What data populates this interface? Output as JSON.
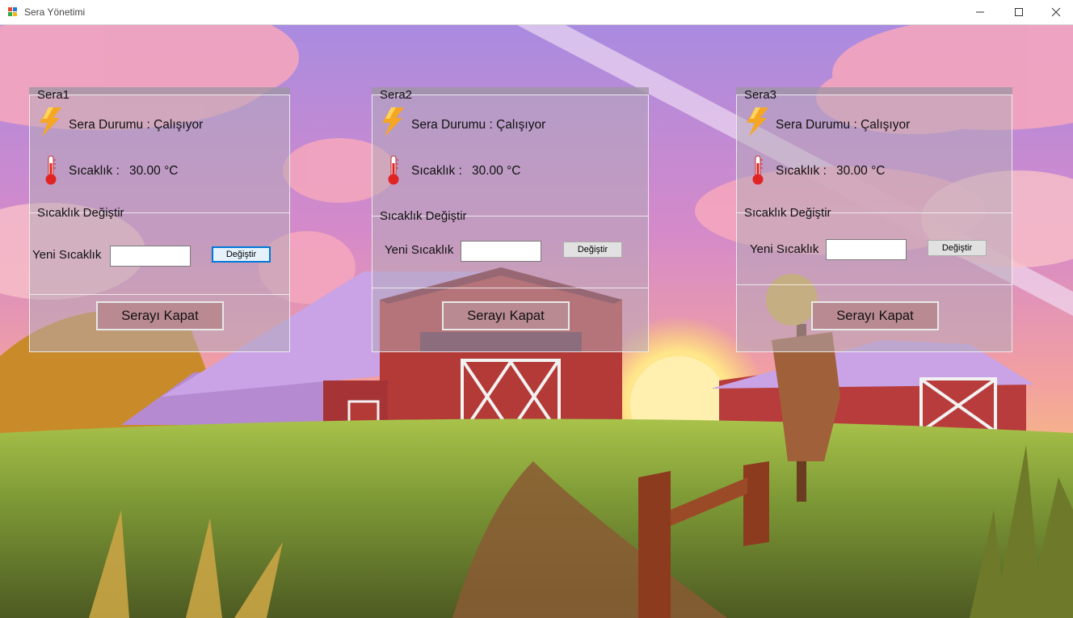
{
  "window": {
    "title": "Sera Yönetimi",
    "icons": [
      "app-icon",
      "minimize-icon",
      "maximize-icon",
      "close-icon"
    ]
  },
  "panels": [
    {
      "title": "Sera1",
      "status_label": "Sera Durumu : Çalışıyor",
      "temp_label": "Sıcaklık :",
      "temp_value": "30.00 °C",
      "change_group_title": "Sıcaklık Değiştir",
      "new_temp_label": "Yeni Sıcaklık",
      "new_temp_value": "",
      "change_button": "Değiştir",
      "close_button": "Serayı Kapat"
    },
    {
      "title": "Sera2",
      "status_label": "Sera Durumu : Çalışıyor",
      "temp_label": "Sıcaklık :",
      "temp_value": "30.00 °C",
      "change_group_title": "Sıcaklık Değiştir",
      "new_temp_label": "Yeni Sıcaklık",
      "new_temp_value": "",
      "change_button": "Değiştir",
      "close_button": "Serayı Kapat"
    },
    {
      "title": "Sera3",
      "status_label": "Sera Durumu : Çalışıyor",
      "temp_label": "Sıcaklık :",
      "temp_value": "30.00 °C",
      "change_group_title": "Sıcaklık Değiştir",
      "new_temp_label": "Yeni Sıcaklık",
      "new_temp_value": "",
      "change_button": "Değiştir",
      "close_button": "Serayı Kapat"
    }
  ],
  "icons": {
    "status": "lightning-icon",
    "temperature": "thermometer-icon"
  },
  "colors": {
    "accent_focus": "#0078d7",
    "close_button_bg": "#b98a92",
    "lightning": "#f5a623",
    "thermometer": "#e02424"
  }
}
